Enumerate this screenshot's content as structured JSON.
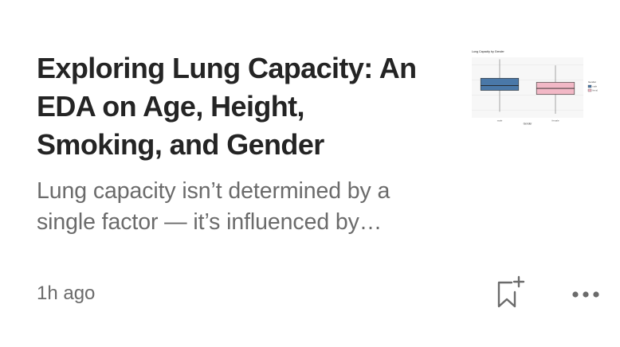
{
  "article": {
    "title": "Exploring Lung Capacity: An EDA on Age, Height, Smoking, and Gender",
    "subtitle": "Lung capacity isn’t determined by a single factor — it’s influenced by…",
    "time_ago": "1h ago"
  },
  "thumbnail": {
    "chart_data": {
      "type": "box",
      "title": "Lung Capacity by Gender",
      "xlabel": "Gender",
      "ylabel": "",
      "categories": [
        "male",
        "female"
      ],
      "legend_title": "Gender",
      "legend_entries": [
        "male",
        "female"
      ],
      "legend_placement": "right",
      "colors": [
        "#4a78a8",
        "#f2b8c6"
      ],
      "ylim": [
        0,
        15
      ],
      "boxes": [
        {
          "category": "male",
          "min": 1.5,
          "q1": 6.8,
          "median": 8.0,
          "q3": 9.8,
          "max": 14.5
        },
        {
          "category": "female",
          "min": 1.0,
          "q1": 5.8,
          "median": 7.3,
          "q3": 8.8,
          "max": 13.0
        }
      ]
    }
  },
  "actions": {
    "bookmark_icon": "bookmark-add-icon",
    "more_icon": "more-horizontal-icon"
  },
  "colors": {
    "title": "#242424",
    "secondary": "#6b6b6b"
  }
}
